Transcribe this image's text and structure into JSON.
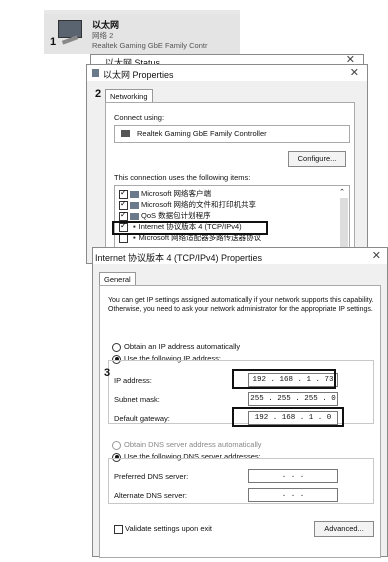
{
  "step_numbers": {
    "step1": "1",
    "step2": "2",
    "step3": "3"
  },
  "adapter": {
    "name": "以太网",
    "network": "网络 2",
    "description": "Realtek Gaming GbE Family Contr"
  },
  "status_window": {
    "title": "以太网 Status"
  },
  "properties_window": {
    "title": "以太网 Properties",
    "tab": "Networking",
    "connect_using_label": "Connect using:",
    "adapter_name": "Realtek Gaming GbE Family Controller",
    "configure_button": "Configure...",
    "items_label": "This connection uses the following items:",
    "items": [
      {
        "label": "Microsoft 网络客户端",
        "checked": true
      },
      {
        "label": "Microsoft 网络的文件和打印机共享",
        "checked": true
      },
      {
        "label": "QoS 数据包计划程序",
        "checked": true
      },
      {
        "label": "Internet 协议版本 4 (TCP/IPv4)",
        "checked": true
      },
      {
        "label": "Microsoft 网络适配器多路传送器协议",
        "checked": false
      }
    ]
  },
  "ipv4_dialog": {
    "title": "Internet 协议版本 4 (TCP/IPv4) Properties",
    "tab": "General",
    "description": "You can get IP settings assigned automatically if your network supports this capability. Otherwise, you need to ask your network administrator for the appropriate IP settings.",
    "radio_auto_ip": "Obtain an IP address automatically",
    "radio_manual_ip": "Use the following IP address:",
    "ip_label": "IP address:",
    "ip_value": "192 . 168 .  1  . 73",
    "mask_label": "Subnet mask:",
    "mask_value": "255 . 255 . 255 .  0",
    "gateway_label": "Default gateway:",
    "gateway_value": "192 . 168 .  1  .  0",
    "radio_auto_dns": "Obtain DNS server address automatically",
    "radio_manual_dns": "Use the following DNS server addresses:",
    "preferred_dns_label": "Preferred DNS server:",
    "preferred_dns_value": ".      .      .",
    "alternate_dns_label": "Alternate DNS server:",
    "alternate_dns_value": ".      .      .",
    "validate_label": "Validate settings upon exit",
    "advanced_button": "Advanced..."
  }
}
